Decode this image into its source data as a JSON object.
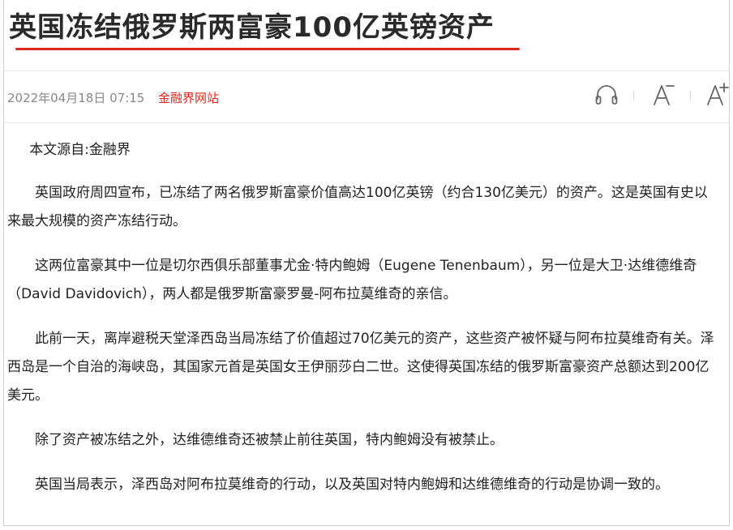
{
  "article": {
    "title": "英国冻结俄罗斯两富豪100亿英镑资产",
    "date": "2022年04月18日 07:15",
    "source": "金融界网站",
    "source_line": "本文源自:金融界",
    "paragraphs": [
      "英国政府周四宣布，已冻结了两名俄罗斯富豪价值高达100亿英镑（约合130亿美元）的资产。这是英国有史以来最大规模的资产冻结行动。",
      "这两位富豪其中一位是切尔西俱乐部董事尤金·特内鲍姆（Eugene Tenenbaum），另一位是大卫·达维德维奇（David Davidovich），两人都是俄罗斯富豪罗曼-阿布拉莫维奇的亲信。",
      "此前一天，离岸避税天堂泽西岛当局冻结了价值超过70亿美元的资产，这些资产被怀疑与阿布拉莫维奇有关。泽西岛是一个自治的海峡岛，其国家元首是英国女王伊丽莎白二世。这使得英国冻结的俄罗斯富豪资产总额达到200亿美元。",
      "除了资产被冻结之外，达维德维奇还被禁止前往英国，特内鲍姆没有被禁止。",
      "英国当局表示，泽西岛对阿布拉莫维奇的行动，以及英国对特内鲍姆和达维德维奇的行动是协调一致的。"
    ]
  },
  "toolbar": {
    "listen_icon": "headphones-icon",
    "font_decrease_icon": "font-decrease-icon",
    "font_increase_icon": "font-increase-icon"
  },
  "colors": {
    "accent": "#e0261c",
    "meta_text": "#888888",
    "body_text": "#222222"
  }
}
